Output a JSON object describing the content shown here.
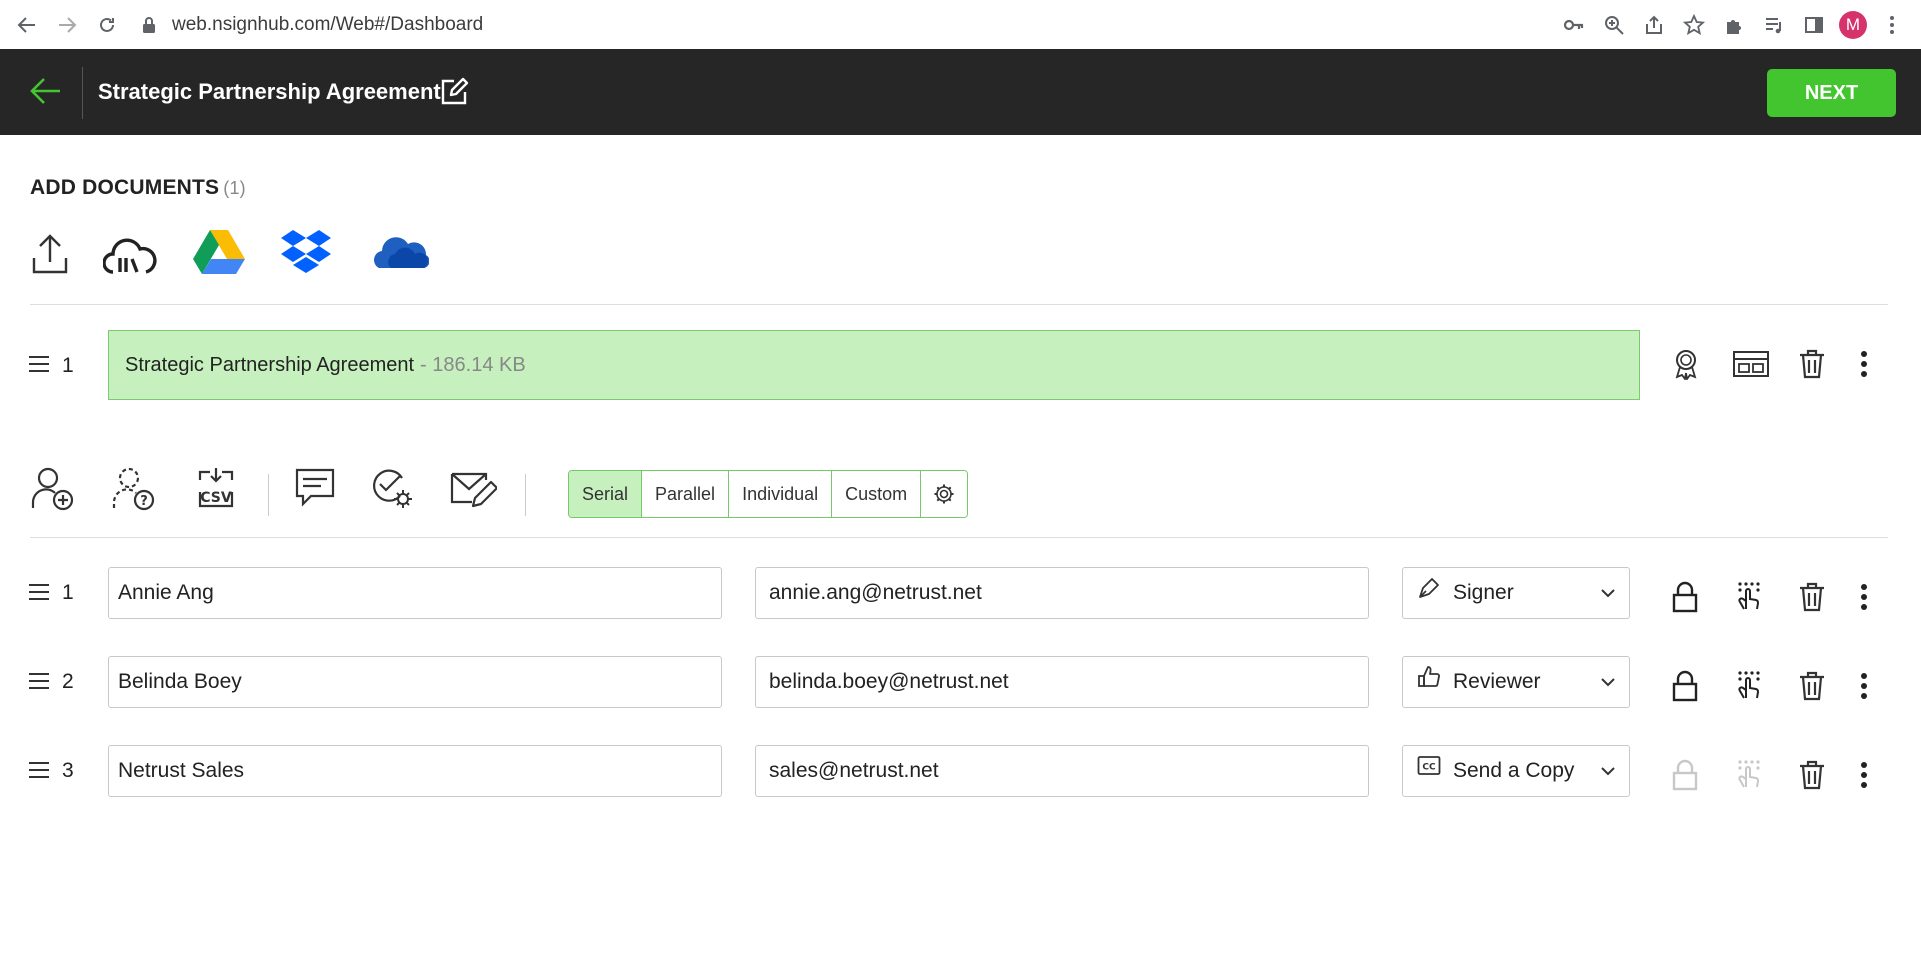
{
  "browser": {
    "url": "web.nsignhub.com/Web#/Dashboard",
    "avatar_letter": "M"
  },
  "header": {
    "title": "Strategic Partnership Agreement",
    "next_label": "NEXT",
    "accent_color": "#43c52f"
  },
  "documents": {
    "heading": "ADD DOCUMENTS",
    "count": "(1)",
    "sources": [
      "upload-icon",
      "cloud-library-icon",
      "google-drive-icon",
      "dropbox-icon",
      "onedrive-icon"
    ],
    "items": [
      {
        "index": "1",
        "name": "Strategic Partnership Agreement",
        "size": "- 186.14 KB"
      }
    ]
  },
  "workflow": {
    "options": [
      "Serial",
      "Parallel",
      "Individual",
      "Custom"
    ],
    "selected": "Serial"
  },
  "recipients": [
    {
      "index": "1",
      "name": "Annie Ang",
      "email": "annie.ang@netrust.net",
      "role": "Signer",
      "role_icon": "pen-icon",
      "lock_enabled": true
    },
    {
      "index": "2",
      "name": "Belinda Boey",
      "email": "belinda.boey@netrust.net",
      "role": "Reviewer",
      "role_icon": "thumbs-up-icon",
      "lock_enabled": true
    },
    {
      "index": "3",
      "name": "Netrust Sales",
      "email": "sales@netrust.net",
      "role": "Send a Copy",
      "role_icon": "cc-icon",
      "lock_enabled": false
    }
  ]
}
